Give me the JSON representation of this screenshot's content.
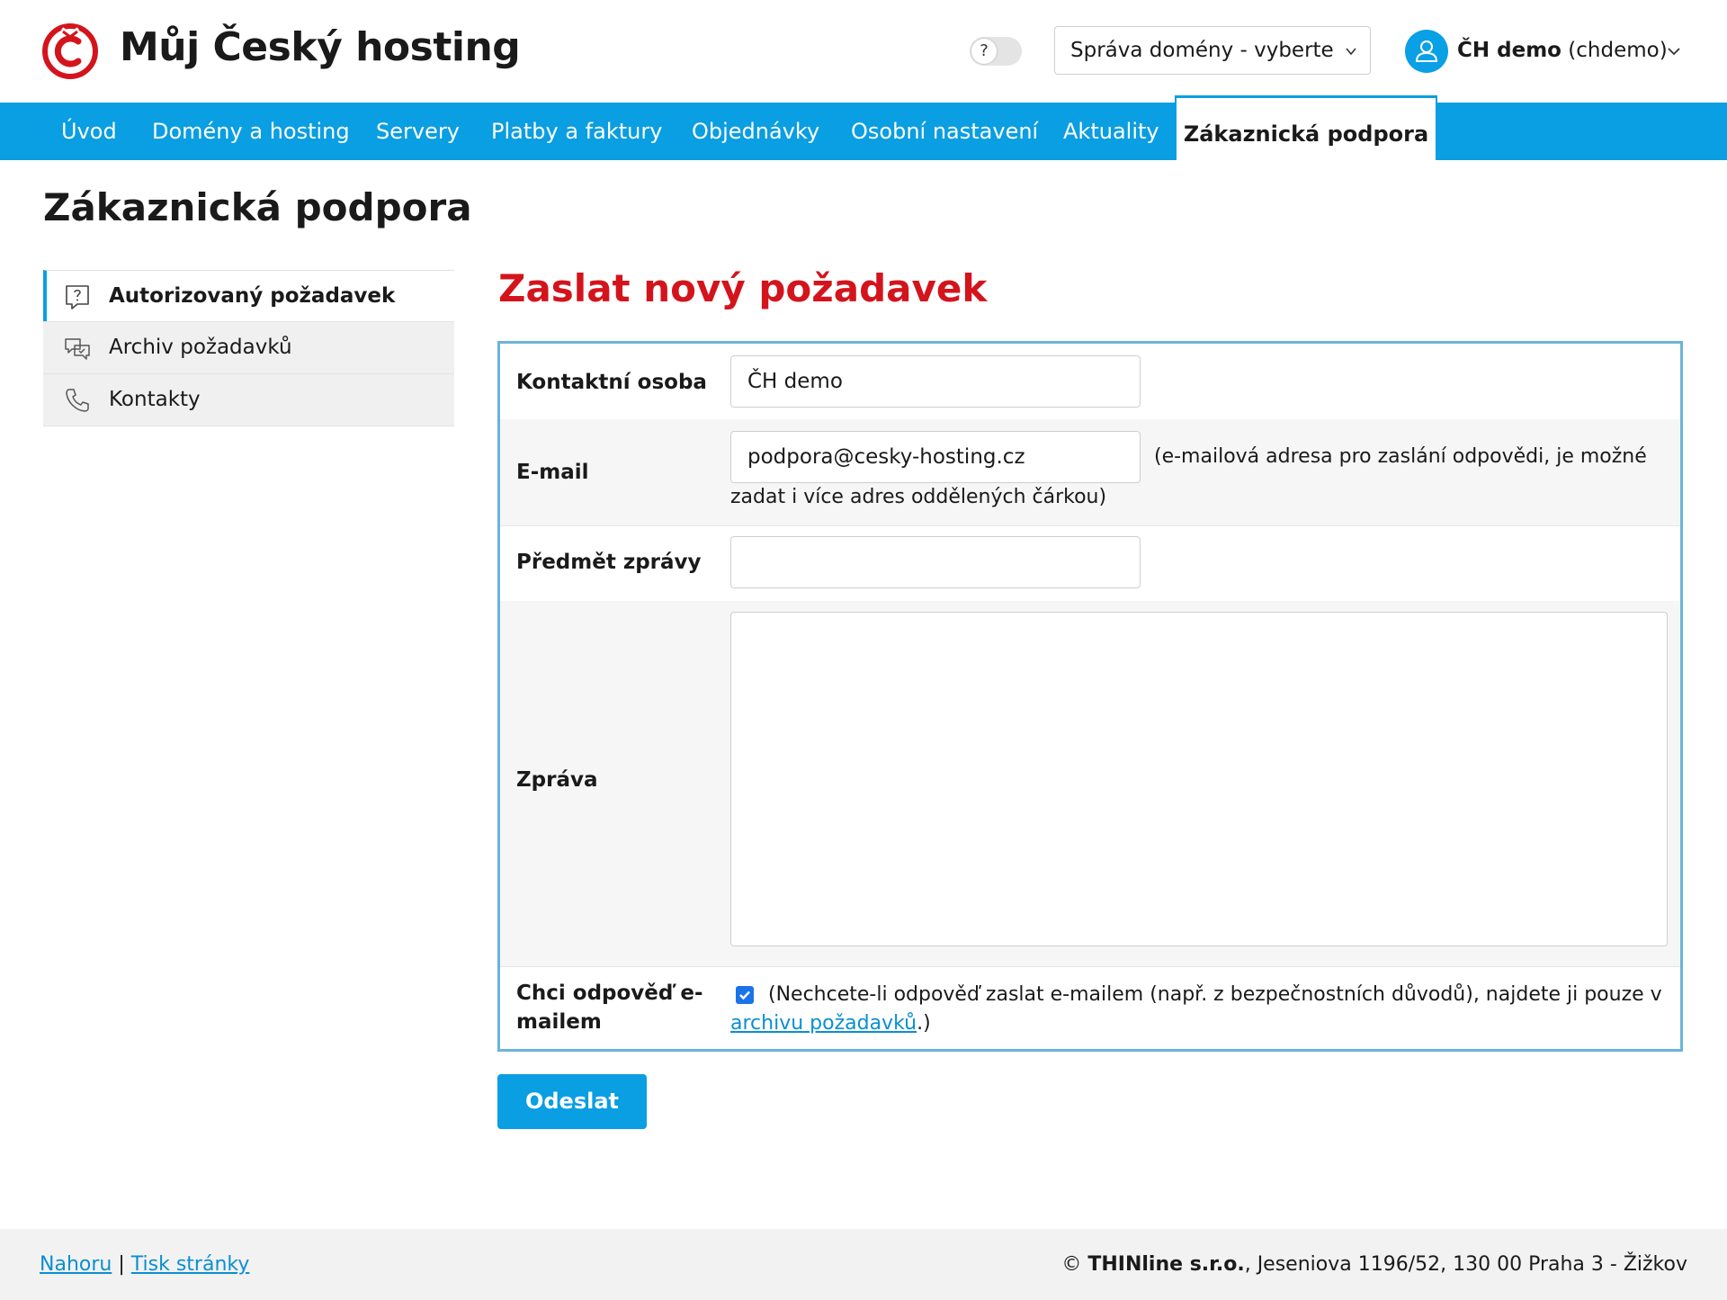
{
  "header": {
    "app_title": "Můj Český hosting",
    "help_toggle_label": "?",
    "domain_select_value": "Správa domény - vyberte",
    "user": {
      "name": "ČH demo",
      "login": "(chdemo)"
    }
  },
  "nav": {
    "items": [
      {
        "label": "Úvod"
      },
      {
        "label": "Domény a hosting"
      },
      {
        "label": "Servery"
      },
      {
        "label": "Platby a faktury"
      },
      {
        "label": "Objednávky"
      },
      {
        "label": "Osobní nastavení"
      },
      {
        "label": "Aktuality"
      },
      {
        "label": "Zákaznická podpora",
        "active": true
      }
    ]
  },
  "page": {
    "title": "Zákaznická podpora"
  },
  "sidebar": {
    "items": [
      {
        "label": "Autorizovaný požadavek",
        "icon": "question-bubble-icon",
        "active": true
      },
      {
        "label": "Archiv požadavků",
        "icon": "chat-archive-icon"
      },
      {
        "label": "Kontakty",
        "icon": "phone-icon"
      }
    ]
  },
  "form": {
    "heading": "Zaslat nový požadavek",
    "contact": {
      "label": "Kontaktní osoba",
      "value": "ČH demo"
    },
    "email": {
      "label": "E-mail",
      "value": "podpora@cesky-hosting.cz",
      "hint_line1": "(e-mailová adresa pro zaslání odpovědi, je možné",
      "hint_line2": "zadat i více adres oddělených čárkou)"
    },
    "subject": {
      "label": "Předmět zprávy",
      "value": ""
    },
    "message": {
      "label": "Zpráva",
      "value": ""
    },
    "reply_by_email": {
      "label_line1": "Chci odpověď e-",
      "label_line2": "mailem",
      "checked": true,
      "text_before": "(Nechcete-li odpověď zaslat e-mailem (např. z bezpečnostních důvodů), najdete ji pouze v ",
      "link_text": "archivu požadavků",
      "text_after": ".)"
    },
    "submit_label": "Odeslat"
  },
  "footer": {
    "link_top": "Nahoru",
    "separator": "|",
    "link_print": "Tisk stránky",
    "company": "THINline s.r.o.",
    "address": ", Jeseniova 1196/52, 130 00 Praha 3 - Žižkov",
    "copyright_symbol": "©"
  },
  "colors": {
    "brand_red": "#d4141c",
    "nav_blue": "#0a9ee2",
    "form_border": "#6bb4d8",
    "link_blue": "#0a8fd1"
  }
}
